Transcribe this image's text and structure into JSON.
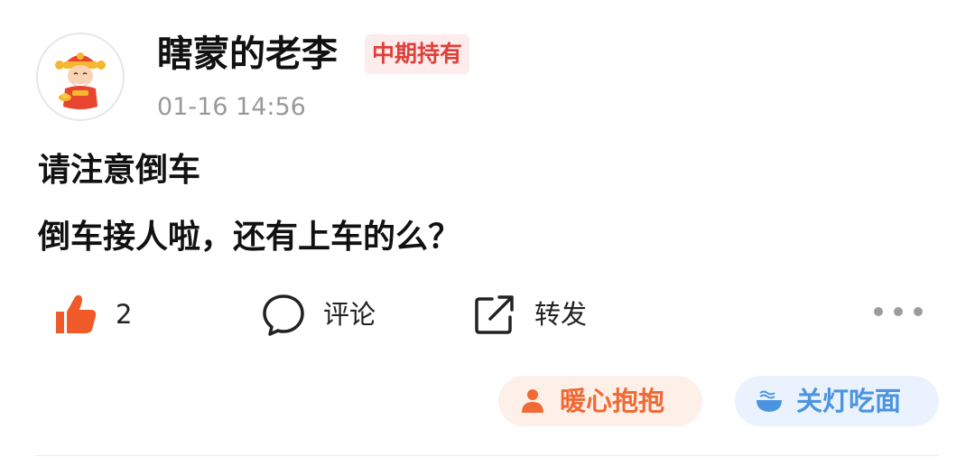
{
  "post": {
    "author": {
      "name": "瞎蒙的老李",
      "badge": "中期持有",
      "avatar_icon": "fortune-god-avatar-icon"
    },
    "timestamp": "01-16 14:56",
    "title": "请注意倒车",
    "body": "倒车接人啦，还有上车的么？"
  },
  "actions": {
    "like": {
      "icon": "thumbs-up-icon",
      "count": "2",
      "color": "#f05a28"
    },
    "comment": {
      "icon": "comment-bubble-icon",
      "label": "评论"
    },
    "share": {
      "icon": "share-icon",
      "label": "转发"
    },
    "more": {
      "icon": "more-dots-icon"
    }
  },
  "reactions": [
    {
      "icon": "person-icon",
      "label": "暖心抱抱",
      "color": "#f06a36",
      "background": "#fdf0e8"
    },
    {
      "icon": "noodle-bowl-icon",
      "label": "关灯吃面",
      "color": "#4a94e0",
      "background": "#eaf3fd"
    }
  ],
  "colors": {
    "badge_text": "#e0403a",
    "badge_background": "#fdecec",
    "timestamp": "#9a9a9a"
  }
}
